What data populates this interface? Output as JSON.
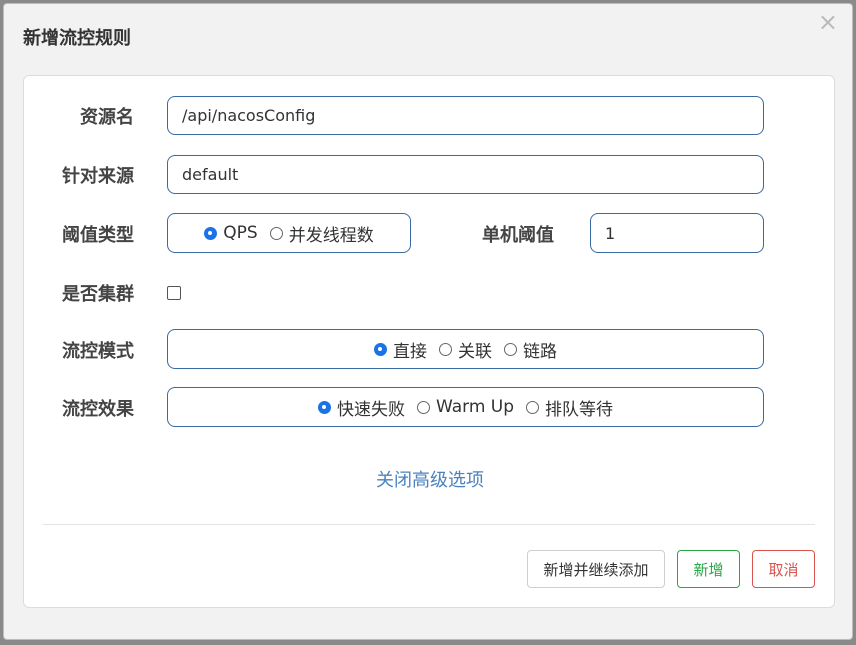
{
  "modal": {
    "title": "新增流控规则",
    "close_glyph": "×"
  },
  "form": {
    "resource": {
      "label": "资源名",
      "value": "/api/nacosConfig"
    },
    "source": {
      "label": "针对来源",
      "value": "default"
    },
    "threshold_type": {
      "label": "阈值类型",
      "options": [
        "QPS",
        "并发线程数"
      ],
      "selected": "QPS"
    },
    "single_threshold": {
      "label": "单机阈值",
      "value": "1"
    },
    "cluster": {
      "label": "是否集群",
      "checked": false
    },
    "flow_mode": {
      "label": "流控模式",
      "options": [
        "直接",
        "关联",
        "链路"
      ],
      "selected": "直接"
    },
    "flow_effect": {
      "label": "流控效果",
      "options": [
        "快速失败",
        "Warm Up",
        "排队等待"
      ],
      "selected": "快速失败"
    },
    "advanced_link": "关闭高级选项"
  },
  "footer": {
    "add_continue_label": "新增并继续添加",
    "add_label": "新增",
    "cancel_label": "取消"
  },
  "colors": {
    "accent_blue": "#1a73e8",
    "input_border": "#3b6aa0",
    "link": "#4b82bf",
    "success_green": "#28a745",
    "danger_red": "#d9534f"
  }
}
